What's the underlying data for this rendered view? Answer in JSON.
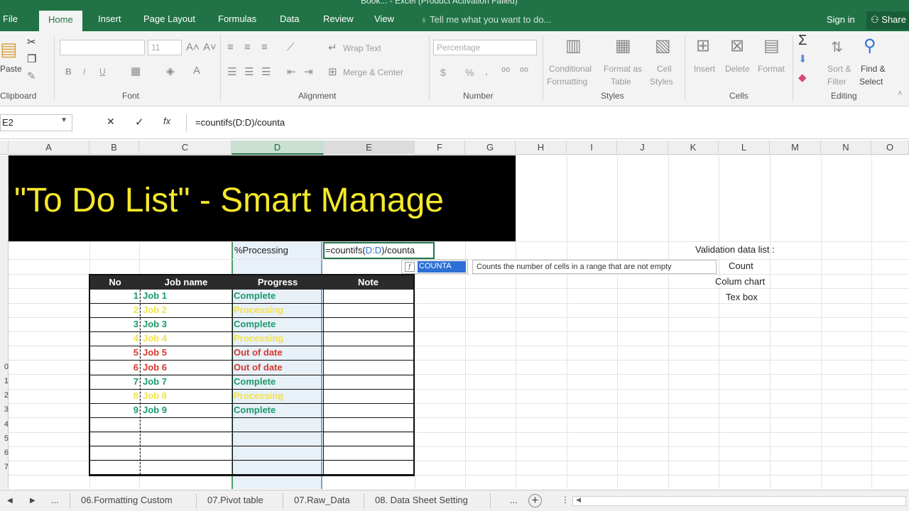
{
  "window": {
    "title": "Book... - Excel (Product Activation Failed)"
  },
  "tabs": [
    "File",
    "Home",
    "Insert",
    "Page Layout",
    "Formulas",
    "Data",
    "Review",
    "View"
  ],
  "tell_me": "Tell me what you want to do...",
  "sign_in": "Sign in",
  "share": "Share",
  "ribbon": {
    "clipboard": {
      "paste": "Paste",
      "name": "Clipboard"
    },
    "font": {
      "size": "11",
      "name": "Font",
      "bold": "B",
      "italic": "I",
      "underline": "U"
    },
    "alignment": {
      "wrap": "Wrap Text",
      "merge": "Merge & Center",
      "name": "Alignment"
    },
    "number": {
      "format": "Percentage",
      "currency": "$",
      "percent": "%",
      "comma": ",",
      "name": "Number"
    },
    "styles": {
      "cond1": "Conditional",
      "cond2": "Formatting",
      "fmt1": "Format as",
      "fmt2": "Table",
      "cell1": "Cell",
      "cell2": "Styles",
      "name": "Styles"
    },
    "cells": {
      "insert": "Insert",
      "delete": "Delete",
      "format": "Format",
      "name": "Cells"
    },
    "editing": {
      "sort1": "Sort &",
      "sort2": "Filter",
      "find1": "Find &",
      "find2": "Select",
      "name": "Editing"
    }
  },
  "formula_bar": {
    "name_box": "E2",
    "cancel": "✕",
    "enter": "✓",
    "fx": "fx",
    "formula": "=countifs(D:D)/counta"
  },
  "columns": [
    "A",
    "B",
    "C",
    "D",
    "E",
    "F",
    "G",
    "H",
    "I",
    "J",
    "K",
    "L",
    "M",
    "N",
    "O"
  ],
  "rows": [
    "",
    "",
    "",
    "",
    "",
    "",
    "",
    "",
    "",
    "0",
    "1",
    "2",
    "3",
    "4",
    "5",
    "6",
    "7"
  ],
  "sheet": {
    "banner": "\"To Do List\" - Smart Manage",
    "processing_label": "%Processing",
    "edit_formula_prefix": "=countifs(",
    "edit_formula_ref": "D:D",
    "edit_formula_suffix": ")/counta",
    "validation_title": "Validation data list :",
    "validation_items": [
      "Count",
      "Colum chart",
      "Tex box"
    ]
  },
  "autocomplete": {
    "function": "COUNTA",
    "description": "Counts the number of cells in a range that are not empty"
  },
  "table": {
    "headers": [
      "No",
      "Job name",
      "Progress",
      "Note"
    ],
    "rows": [
      {
        "no": "1",
        "job": "Job 1",
        "progress": "Complete",
        "color": "#1a9a6a"
      },
      {
        "no": "2",
        "job": "Job 2",
        "progress": "Processing",
        "color": "#f2e24a"
      },
      {
        "no": "3",
        "job": "Job 3",
        "progress": "Complete",
        "color": "#1a9a6a"
      },
      {
        "no": "4",
        "job": "Job 4",
        "progress": "Processing",
        "color": "#f2e24a"
      },
      {
        "no": "5",
        "job": "Job 5",
        "progress": "Out of date",
        "color": "#d33a2c"
      },
      {
        "no": "6",
        "job": "Job 6",
        "progress": "Out of date",
        "color": "#d33a2c"
      },
      {
        "no": "7",
        "job": "Job 7",
        "progress": "Complete",
        "color": "#1a9a6a"
      },
      {
        "no": "8",
        "job": "Job 8",
        "progress": "Processing",
        "color": "#f2e24a"
      },
      {
        "no": "9",
        "job": "Job 9",
        "progress": "Complete",
        "color": "#1a9a6a"
      }
    ],
    "empty_rows": 4
  },
  "sheet_tabs": {
    "prev": "◀",
    "next": "▶",
    "more": "...",
    "tabs": [
      "06.Formatting Custom",
      "07.Pivot table",
      "07.Raw_Data",
      "08. Data Sheet Setting"
    ],
    "more_right": "...",
    "add": "+"
  },
  "colors": {
    "excel_green": "#217346",
    "banner_bg": "#000000",
    "banner_text": "#f5e82a",
    "complete": "#1a9a6a",
    "processing": "#f2e24a",
    "out_of_date": "#d33a2c"
  }
}
